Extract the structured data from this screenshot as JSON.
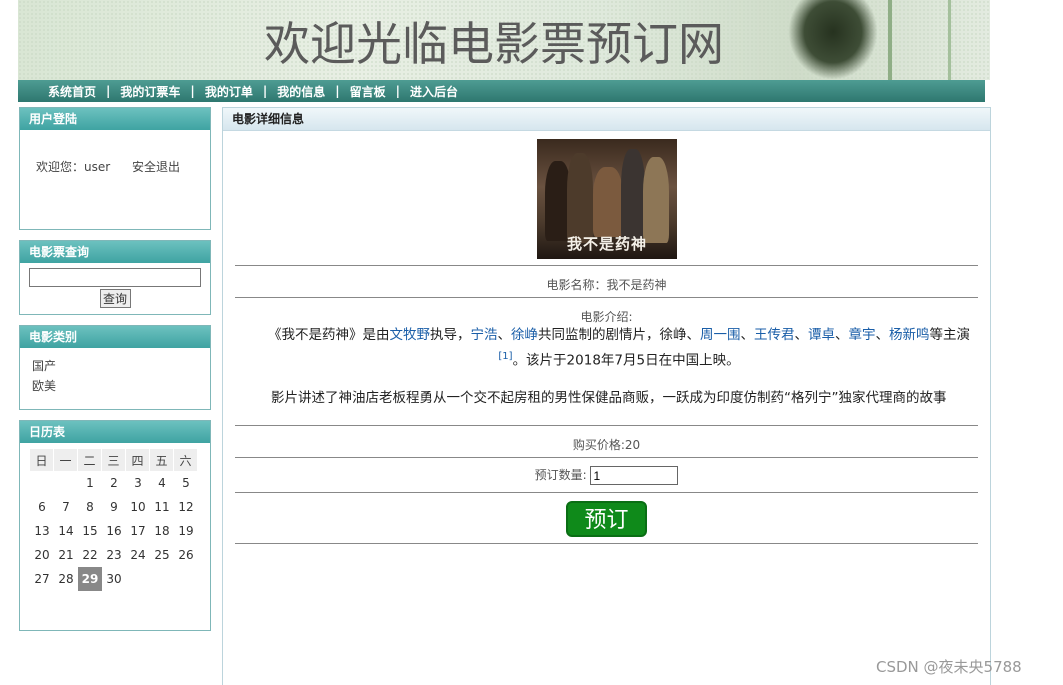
{
  "banner": {
    "title": "欢迎光临电影票预订网"
  },
  "nav": [
    {
      "label": "系统首页"
    },
    {
      "label": "我的订票车"
    },
    {
      "label": "我的订单"
    },
    {
      "label": "我的信息"
    },
    {
      "label": "留言板"
    },
    {
      "label": "进入后台"
    }
  ],
  "nav_sep": "|",
  "login": {
    "title": "用户登陆",
    "welcome": "欢迎您：user",
    "logout": "安全退出"
  },
  "search": {
    "title": "电影票查询",
    "value": "",
    "button": "查询"
  },
  "category": {
    "title": "电影类别",
    "items": [
      "国产",
      "欧美"
    ]
  },
  "calendar": {
    "title": "日历表",
    "weekdays": [
      "日",
      "一",
      "二",
      "三",
      "四",
      "五",
      "六"
    ],
    "weeks": [
      [
        "",
        "",
        "1",
        "2",
        "3",
        "4",
        "5"
      ],
      [
        "6",
        "7",
        "8",
        "9",
        "10",
        "11",
        "12"
      ],
      [
        "13",
        "14",
        "15",
        "16",
        "17",
        "18",
        "19"
      ],
      [
        "20",
        "21",
        "22",
        "23",
        "24",
        "25",
        "26"
      ],
      [
        "27",
        "28",
        "29",
        "30",
        "",
        "",
        ""
      ]
    ],
    "today": "29"
  },
  "detail": {
    "title": "电影详细信息",
    "poster_text": "我不是药神",
    "name_label": "电影名称：我不是药神",
    "intro_label": "电影介绍:",
    "intro": {
      "p1_a": "《我不是药神》是由",
      "director": "文牧野",
      "p1_b": "执导，",
      "a1": "宁浩",
      "sep1": "、",
      "a2": "徐峥",
      "p1_c": "共同监制的剧情片，徐峥、",
      "a3": "周一围",
      "sep2": "、",
      "a4": "王传君",
      "sep3": "、",
      "a5": "谭卓",
      "sep4": "、",
      "a6": "章宇",
      "sep5": "、",
      "a7": "杨新鸣",
      "p1_d": "等主演",
      "ref": "[1]",
      "p1_e": "。该片于2018年7月5日在中国上映。",
      "p2": "影片讲述了神油店老板程勇从一个交不起房租的男性保健品商贩，一跃成为印度仿制药“格列宁”独家代理商的故事"
    },
    "price_label": "购买价格:20",
    "qty_label": "预订数量:",
    "qty_value": "1",
    "order_button": "预订"
  },
  "watermark": "CSDN @夜未央5788"
}
